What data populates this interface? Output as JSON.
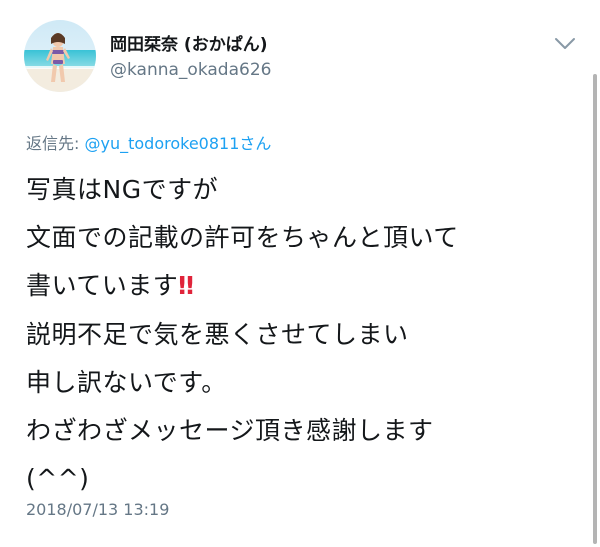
{
  "user": {
    "display_name": "岡田栞奈 (おかぱん)",
    "handle": "@kanna_okada626"
  },
  "reply": {
    "prefix": "返信先: ",
    "mention": "@yu_todoroke0811さん"
  },
  "tweet": {
    "lines": [
      "写真はNGですが",
      "文面での記載の許可をちゃんと頂いて",
      "書いています",
      "説明不足で気を悪くさせてしまい",
      "申し訳ないです。",
      "わざわざメッセージ頂き感謝します",
      "(^^)"
    ],
    "emoji": "‼"
  },
  "timestamp": "2018/07/13 13:19",
  "icons": {
    "avatar": "avatar-beach-photo",
    "menu": "chevron-down-icon",
    "emoji": "double-exclamation-icon"
  },
  "colors": {
    "text": "#14171a",
    "muted": "#657786",
    "link": "#1da1f2",
    "emoji_red": "#e0243a"
  }
}
